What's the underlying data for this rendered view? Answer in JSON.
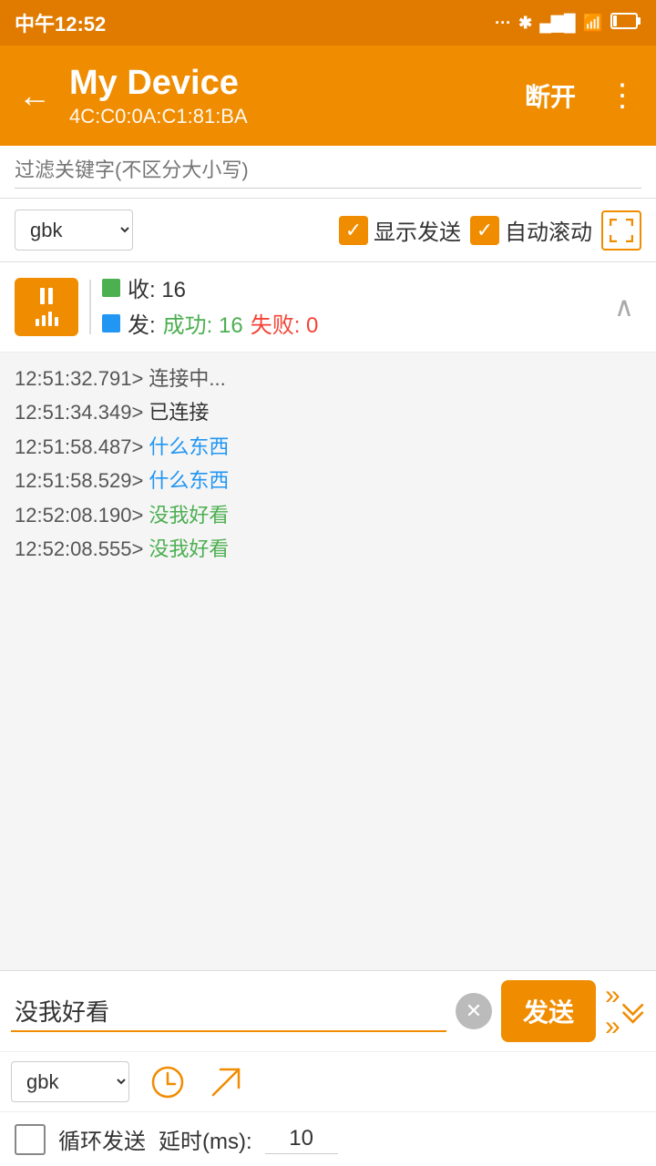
{
  "statusBar": {
    "time": "中午12:52",
    "battery": "2"
  },
  "header": {
    "title": "My Device",
    "subtitle": "4C:C0:0A:C1:81:BA",
    "disconnect": "断开",
    "moreIcon": "⋮"
  },
  "filter": {
    "placeholder": "过滤关键字(不区分大小写)"
  },
  "options": {
    "encoding1": "gbk",
    "showSend": "显示发送",
    "autoScroll": "自动滚动"
  },
  "stats": {
    "recvLabel": "收: 16",
    "sendLabel": "发: 成功: 16 失败: 0",
    "recvCount": "16",
    "sendSuccess": "16",
    "sendFail": "0"
  },
  "logs": [
    {
      "time": "12:51:32.791>",
      "message": "连接中...",
      "type": "normal"
    },
    {
      "time": "12:51:34.349>",
      "message": "已连接",
      "type": "normal"
    },
    {
      "time": "12:51:58.487>",
      "message": "什么东西",
      "type": "blue"
    },
    {
      "time": "12:51:58.529>",
      "message": "什么东西",
      "type": "blue"
    },
    {
      "time": "12:52:08.190>",
      "message": "没我好看",
      "type": "green"
    },
    {
      "time": "12:52:08.555>",
      "message": "没我好看",
      "type": "green"
    }
  ],
  "input": {
    "value": "没我好看",
    "placeholder": ""
  },
  "bottomEncoding": "gbk",
  "loop": {
    "label": "循环发送",
    "delayLabel": "延时(ms):",
    "delayValue": "10"
  },
  "buttons": {
    "send": "发送"
  }
}
